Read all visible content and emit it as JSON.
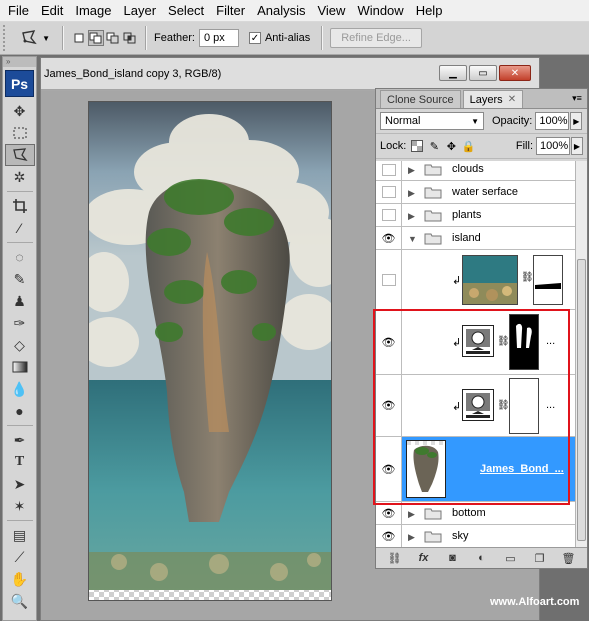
{
  "menubar": {
    "items": [
      "File",
      "Edit",
      "Image",
      "Layer",
      "Select",
      "Filter",
      "Analysis",
      "View",
      "Window",
      "Help"
    ]
  },
  "options": {
    "feather_label": "Feather:",
    "feather_value": "0 px",
    "antialias_label": "Anti-alias",
    "antialias_checked": true,
    "refine_label": "Refine Edge..."
  },
  "toolbox": {
    "logo": "Ps"
  },
  "document": {
    "title": "James_Bond_island copy 3, RGB/8)"
  },
  "layers_panel": {
    "tabs": [
      "Clone Source",
      "Layers"
    ],
    "active_tab": "Layers",
    "blend_mode": "Normal",
    "opacity_label": "Opacity:",
    "opacity_value": "100%",
    "lock_label": "Lock:",
    "fill_label": "Fill:",
    "fill_value": "100%",
    "layers": [
      {
        "name": "clouds",
        "kind": "group",
        "visible": false,
        "expanded": false
      },
      {
        "name": "water serface",
        "kind": "group",
        "visible": false,
        "expanded": false
      },
      {
        "name": "plants",
        "kind": "group",
        "visible": false,
        "expanded": false
      },
      {
        "name": "island",
        "kind": "group",
        "visible": true,
        "expanded": true
      },
      {
        "name": "",
        "kind": "layer",
        "visible": false,
        "thumbnail": "sea-bottom"
      },
      {
        "name": "...",
        "kind": "adjustment",
        "visible": true,
        "mask": "mask-white-stroke"
      },
      {
        "name": "...",
        "kind": "adjustment",
        "visible": true,
        "mask": "mask-white"
      },
      {
        "name": "James_Bond_...",
        "kind": "layer",
        "visible": true,
        "selected": true,
        "thumbnail": "island-rock"
      },
      {
        "name": "bottom",
        "kind": "group",
        "visible": true,
        "expanded": false
      },
      {
        "name": "sky",
        "kind": "group",
        "visible": true,
        "expanded": false
      }
    ],
    "bottom_icons": [
      "link-icon",
      "fx-icon",
      "mask-icon",
      "adjustment-icon",
      "folder-icon",
      "new-layer-icon",
      "trash-icon"
    ]
  },
  "watermark": "www.Alfoart.com",
  "colors": {
    "selection": "#3399ff",
    "highlight": "#e0131b",
    "ps_blue": "#1c4b99"
  }
}
